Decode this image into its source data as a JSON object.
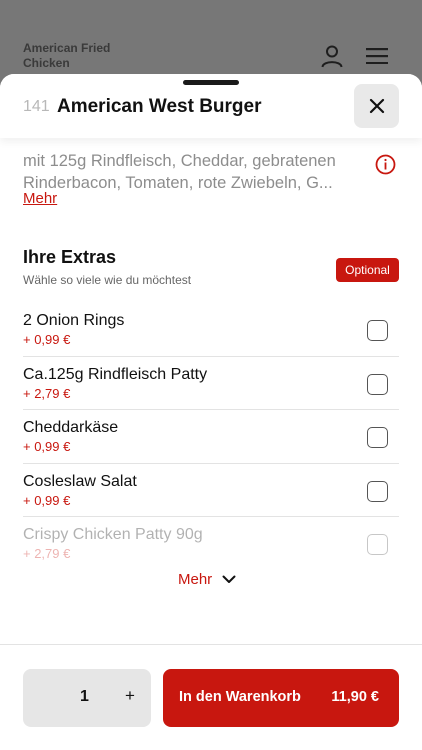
{
  "background": {
    "restaurant_name": "American Fried Chicken",
    "icons": [
      "user-icon",
      "hamburger-menu-icon"
    ]
  },
  "sheet": {
    "item_number": "141",
    "item_title": "American West Burger",
    "description": "mit 125g Rindfleisch, Cheddar, gebratenen Rinderbacon, Tomaten, rote Zwiebeln, G...",
    "description_more": "Mehr",
    "info_icon": "info-circle-icon"
  },
  "extras": {
    "title": "Ihre Extras",
    "subtitle": "Wähle so viele wie du möchtest",
    "badge": "Optional",
    "items": [
      {
        "name": "2 Onion Rings",
        "price": "+ 0,99 €",
        "checked": false
      },
      {
        "name": "Ca.125g Rindfleisch Patty",
        "price": "+ 2,79 €",
        "checked": false
      },
      {
        "name": "Cheddarkäse",
        "price": "+ 0,99 €",
        "checked": false
      },
      {
        "name": "Cosleslaw Salat",
        "price": "+ 0,99 €",
        "checked": false
      },
      {
        "name": "Crispy Chicken Patty 90g",
        "price": "+ 2,79 €",
        "checked": false
      }
    ],
    "more_label": "Mehr"
  },
  "footer": {
    "quantity": "1",
    "plus_label": "+",
    "cart_label": "In den Warenkorb",
    "cart_price": "11,90 €"
  },
  "colors": {
    "accent": "#c8170f",
    "overlay": "#777777"
  }
}
